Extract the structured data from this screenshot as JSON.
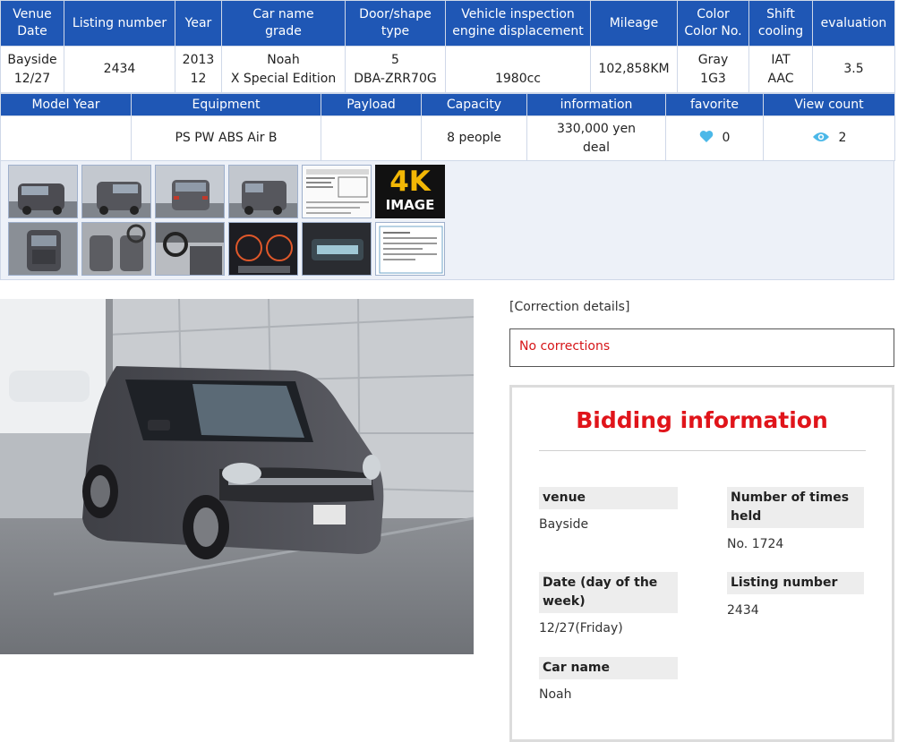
{
  "spec_table_1": {
    "headers": [
      [
        "Venue",
        "Date"
      ],
      [
        "Listing number"
      ],
      [
        "Year"
      ],
      [
        "Car name",
        "grade"
      ],
      [
        "Door/shape",
        "type"
      ],
      [
        "Vehicle inspection",
        "engine displacement"
      ],
      [
        "Mileage"
      ],
      [
        "Color",
        "Color No."
      ],
      [
        "Shift",
        "cooling"
      ],
      [
        "evaluation"
      ]
    ],
    "values": [
      [
        "Bayside",
        "12/27"
      ],
      [
        "2434"
      ],
      [
        "2013",
        "12"
      ],
      [
        "Noah",
        "X Special Edition"
      ],
      [
        "5",
        "DBA-ZRR70G"
      ],
      [
        "",
        "1980cc"
      ],
      [
        "102,858KM"
      ],
      [
        "Gray",
        "1G3"
      ],
      [
        "IAT",
        "AAC"
      ],
      [
        "3.5"
      ]
    ]
  },
  "spec_table_2": {
    "headers": [
      "Model Year",
      "Equipment",
      "Payload",
      "Capacity",
      "information",
      "favorite",
      "View count"
    ],
    "values": {
      "model_year": "",
      "equipment": "PS PW ABS Air B",
      "payload": "",
      "capacity": "8 people",
      "information": [
        "330,000 yen",
        "deal"
      ],
      "favorite_count": "0",
      "view_count": "2"
    }
  },
  "thumbnails": [
    "front-left-exterior",
    "front-right-exterior",
    "rear-exterior",
    "rear-left-exterior",
    "auction-sheet",
    "4k-image",
    "rear-top-view",
    "front-seats-interior",
    "dashboard-interior",
    "instrument-cluster",
    "odometer-display",
    "inspection-document"
  ],
  "badge_4k": {
    "line1": "4K",
    "line2": "IMAGE"
  },
  "correction": {
    "label": "[Correction details]",
    "text": "No corrections"
  },
  "bidding": {
    "title": "Bidding information",
    "fields": {
      "venue_label": "venue",
      "venue_value": "Bayside",
      "held_label": "Number of times held",
      "held_value": "No. 1724",
      "date_label": "Date (day of the week)",
      "date_value": "12/27(Friday)",
      "listing_label": "Listing number",
      "listing_value": "2434",
      "carname_label": "Car name",
      "carname_value": "Noah"
    }
  },
  "colors": {
    "header_blue": "#1f57b5",
    "heart_blue": "#4bb8e8",
    "alert_red": "#e0141a"
  }
}
